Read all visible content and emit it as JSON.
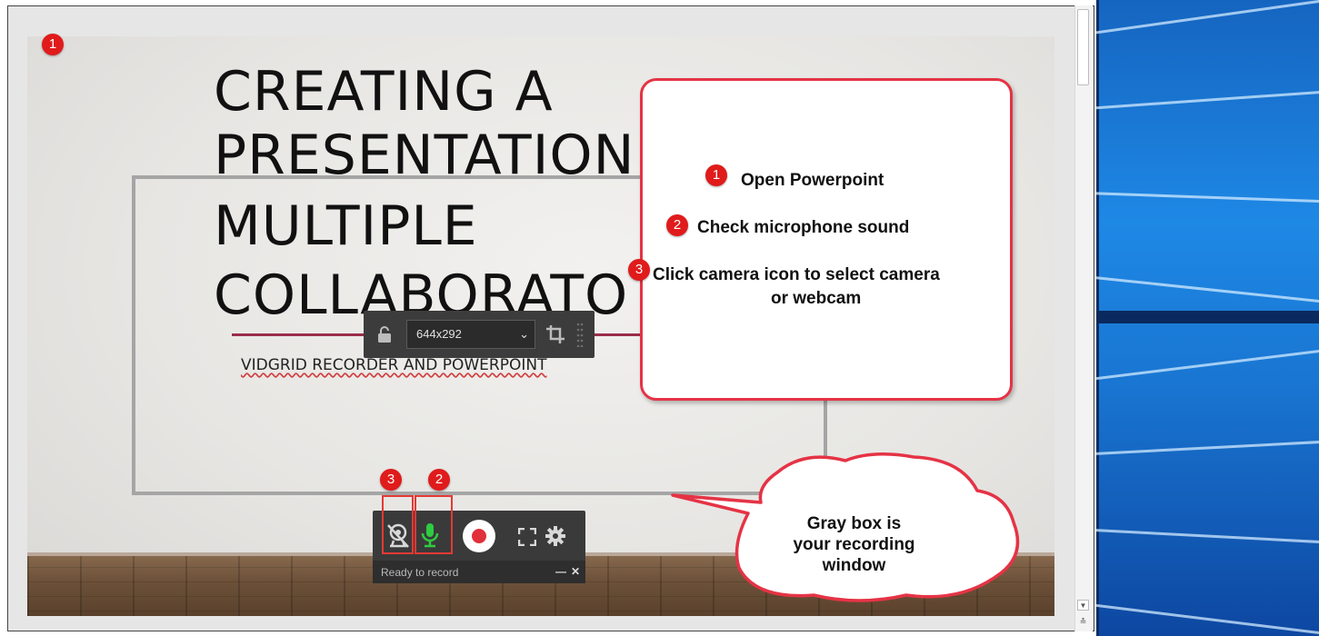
{
  "slide": {
    "title_lines": [
      "CREATING A",
      "PRESENTATION",
      "MULTIPLE",
      "COLLABORATO"
    ],
    "subtitle": "VIDGRID RECORDER AND POWERPOINT"
  },
  "size_toolbar": {
    "resolution": "644x292",
    "icons": [
      "lock-icon",
      "chevron-down-icon",
      "crop-icon",
      "drag-grip-icon"
    ]
  },
  "recorder": {
    "status": "Ready to record",
    "minimize_label": "—",
    "close_label": "✕",
    "icons": [
      "webcam-icon",
      "microphone-icon",
      "record-button",
      "fullscreen-icon",
      "gear-icon"
    ],
    "mic_color": "#2ecc40",
    "record_color": "#e0303a"
  },
  "callout": {
    "steps": [
      {
        "number": "1",
        "text": "Open Powerpoint"
      },
      {
        "number": "2",
        "text": "Check microphone sound"
      },
      {
        "number": "3",
        "text": "Click camera icon to select camera",
        "text2": "or webcam"
      }
    ],
    "border_color": "#e53345"
  },
  "markers": {
    "slide_marker": "1",
    "camera_marker": "3",
    "mic_marker": "2"
  },
  "cloud": {
    "lines": [
      "Gray box is",
      "your recording",
      "window"
    ]
  },
  "colors": {
    "accent_red": "#e01b1b",
    "desktop_blue": "#1976d2"
  }
}
